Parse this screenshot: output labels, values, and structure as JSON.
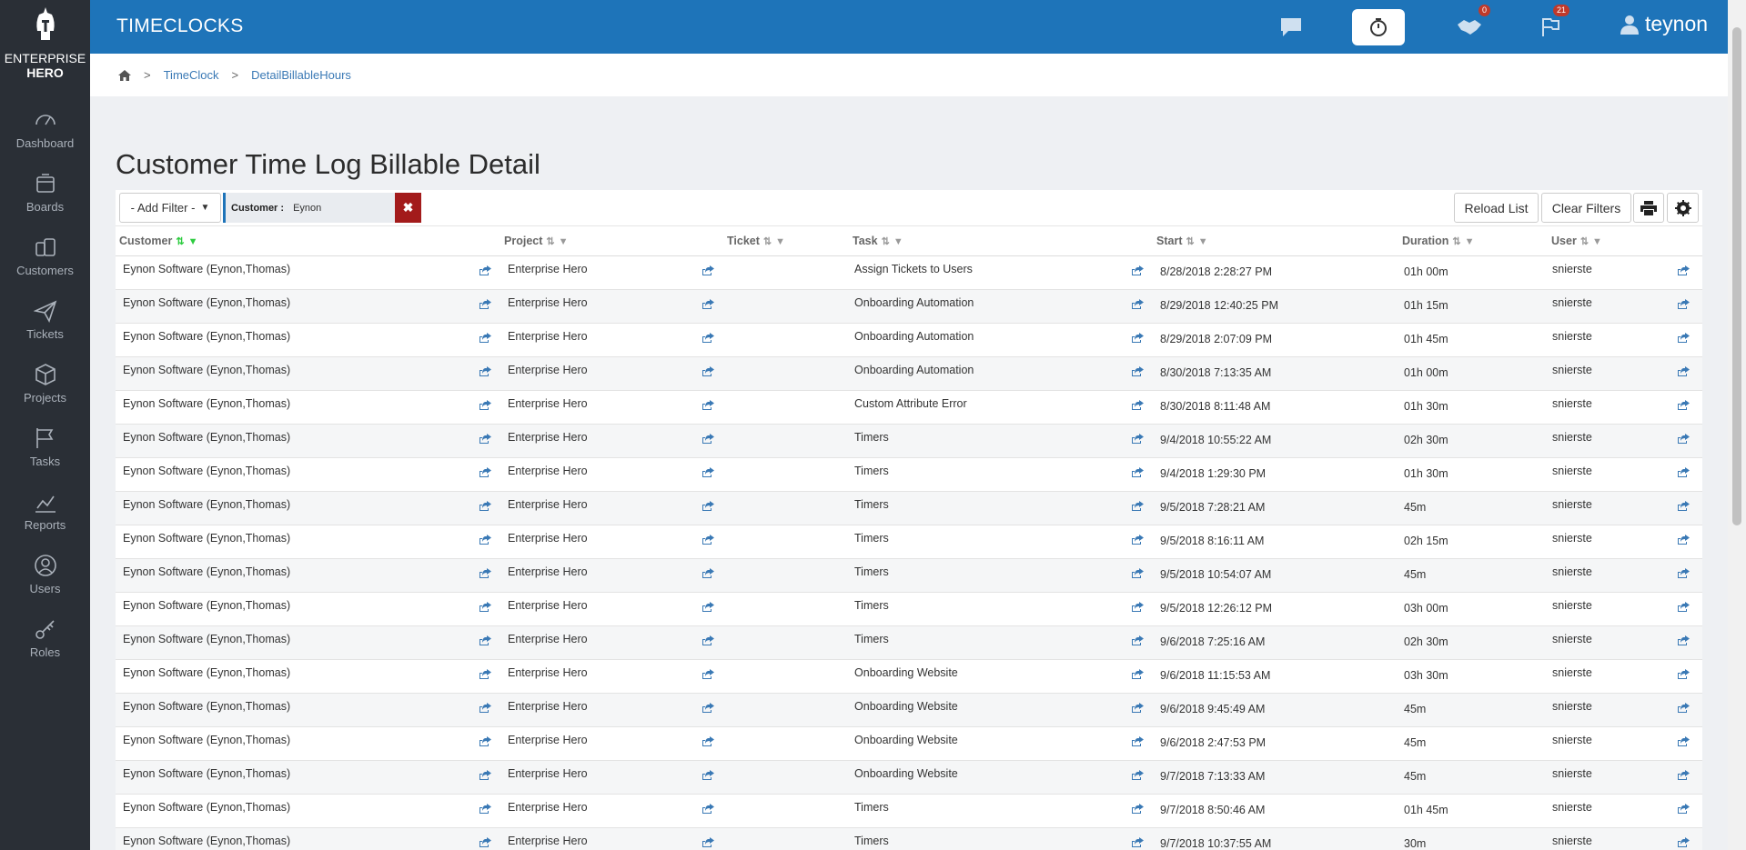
{
  "sidebar": {
    "logo_line1": "ENTERPRISE",
    "logo_line2": "HERO",
    "items": [
      {
        "label": "Dashboard",
        "icon": "dashboard-icon"
      },
      {
        "label": "Boards",
        "icon": "boards-icon"
      },
      {
        "label": "Customers",
        "icon": "customers-icon"
      },
      {
        "label": "Tickets",
        "icon": "tickets-icon"
      },
      {
        "label": "Projects",
        "icon": "projects-icon"
      },
      {
        "label": "Tasks",
        "icon": "tasks-icon"
      },
      {
        "label": "Reports",
        "icon": "reports-icon"
      },
      {
        "label": "Users",
        "icon": "users-icon"
      },
      {
        "label": "Roles",
        "icon": "roles-icon"
      }
    ]
  },
  "header": {
    "title": "TIMECLOCKS",
    "hands_badge": "0",
    "flags_badge": "21",
    "username": "teynon"
  },
  "breadcrumb": [
    "TimeClock",
    "DetailBillableHours"
  ],
  "page_title": "Customer Time Log Billable Detail",
  "filters": {
    "add_filter_label": "- Add Filter -",
    "chip_key": "Customer :",
    "chip_value": "Eynon",
    "reload_label": "Reload List",
    "clear_label": "Clear Filters"
  },
  "columns": [
    "Customer",
    "Project",
    "Ticket",
    "Task",
    "Start",
    "Duration",
    "User"
  ],
  "rows": [
    {
      "customer": "Eynon Software (Eynon,Thomas)",
      "project": "Enterprise Hero",
      "ticket": "",
      "task": "Assign Tickets to Users",
      "start": "8/28/2018 2:28:27 PM",
      "duration": "01h 00m",
      "user": "snierste"
    },
    {
      "customer": "Eynon Software (Eynon,Thomas)",
      "project": "Enterprise Hero",
      "ticket": "",
      "task": "Onboarding Automation",
      "start": "8/29/2018 12:40:25 PM",
      "duration": "01h 15m",
      "user": "snierste"
    },
    {
      "customer": "Eynon Software (Eynon,Thomas)",
      "project": "Enterprise Hero",
      "ticket": "",
      "task": "Onboarding Automation",
      "start": "8/29/2018 2:07:09 PM",
      "duration": "01h 45m",
      "user": "snierste"
    },
    {
      "customer": "Eynon Software (Eynon,Thomas)",
      "project": "Enterprise Hero",
      "ticket": "",
      "task": "Onboarding Automation",
      "start": "8/30/2018 7:13:35 AM",
      "duration": "01h 00m",
      "user": "snierste"
    },
    {
      "customer": "Eynon Software (Eynon,Thomas)",
      "project": "Enterprise Hero",
      "ticket": "",
      "task": "Custom Attribute Error",
      "start": "8/30/2018 8:11:48 AM",
      "duration": "01h 30m",
      "user": "snierste"
    },
    {
      "customer": "Eynon Software (Eynon,Thomas)",
      "project": "Enterprise Hero",
      "ticket": "",
      "task": "Timers",
      "start": "9/4/2018 10:55:22 AM",
      "duration": "02h 30m",
      "user": "snierste"
    },
    {
      "customer": "Eynon Software (Eynon,Thomas)",
      "project": "Enterprise Hero",
      "ticket": "",
      "task": "Timers",
      "start": "9/4/2018 1:29:30 PM",
      "duration": "01h 30m",
      "user": "snierste"
    },
    {
      "customer": "Eynon Software (Eynon,Thomas)",
      "project": "Enterprise Hero",
      "ticket": "",
      "task": "Timers",
      "start": "9/5/2018 7:28:21 AM",
      "duration": "45m",
      "user": "snierste"
    },
    {
      "customer": "Eynon Software (Eynon,Thomas)",
      "project": "Enterprise Hero",
      "ticket": "",
      "task": "Timers",
      "start": "9/5/2018 8:16:11 AM",
      "duration": "02h 15m",
      "user": "snierste"
    },
    {
      "customer": "Eynon Software (Eynon,Thomas)",
      "project": "Enterprise Hero",
      "ticket": "",
      "task": "Timers",
      "start": "9/5/2018 10:54:07 AM",
      "duration": "45m",
      "user": "snierste"
    },
    {
      "customer": "Eynon Software (Eynon,Thomas)",
      "project": "Enterprise Hero",
      "ticket": "",
      "task": "Timers",
      "start": "9/5/2018 12:26:12 PM",
      "duration": "03h 00m",
      "user": "snierste"
    },
    {
      "customer": "Eynon Software (Eynon,Thomas)",
      "project": "Enterprise Hero",
      "ticket": "",
      "task": "Timers",
      "start": "9/6/2018 7:25:16 AM",
      "duration": "02h 30m",
      "user": "snierste"
    },
    {
      "customer": "Eynon Software (Eynon,Thomas)",
      "project": "Enterprise Hero",
      "ticket": "",
      "task": "Onboarding Website",
      "start": "9/6/2018 11:15:53 AM",
      "duration": "03h 30m",
      "user": "snierste"
    },
    {
      "customer": "Eynon Software (Eynon,Thomas)",
      "project": "Enterprise Hero",
      "ticket": "",
      "task": "Onboarding Website",
      "start": "9/6/2018 9:45:49 AM",
      "duration": "45m",
      "user": "snierste"
    },
    {
      "customer": "Eynon Software (Eynon,Thomas)",
      "project": "Enterprise Hero",
      "ticket": "",
      "task": "Onboarding Website",
      "start": "9/6/2018 2:47:53 PM",
      "duration": "45m",
      "user": "snierste"
    },
    {
      "customer": "Eynon Software (Eynon,Thomas)",
      "project": "Enterprise Hero",
      "ticket": "",
      "task": "Onboarding Website",
      "start": "9/7/2018 7:13:33 AM",
      "duration": "45m",
      "user": "snierste"
    },
    {
      "customer": "Eynon Software (Eynon,Thomas)",
      "project": "Enterprise Hero",
      "ticket": "",
      "task": "Timers",
      "start": "9/7/2018 8:50:46 AM",
      "duration": "01h 45m",
      "user": "snierste"
    },
    {
      "customer": "Eynon Software (Eynon,Thomas)",
      "project": "Enterprise Hero",
      "ticket": "",
      "task": "Timers",
      "start": "9/7/2018 10:37:55 AM",
      "duration": "30m",
      "user": "snierste"
    }
  ],
  "colors": {
    "topbar": "#1e74b9",
    "sidebar": "#2a2f36",
    "link": "#3a79b5",
    "danger": "#a31b1b",
    "sort_active": "#2ecc40"
  }
}
